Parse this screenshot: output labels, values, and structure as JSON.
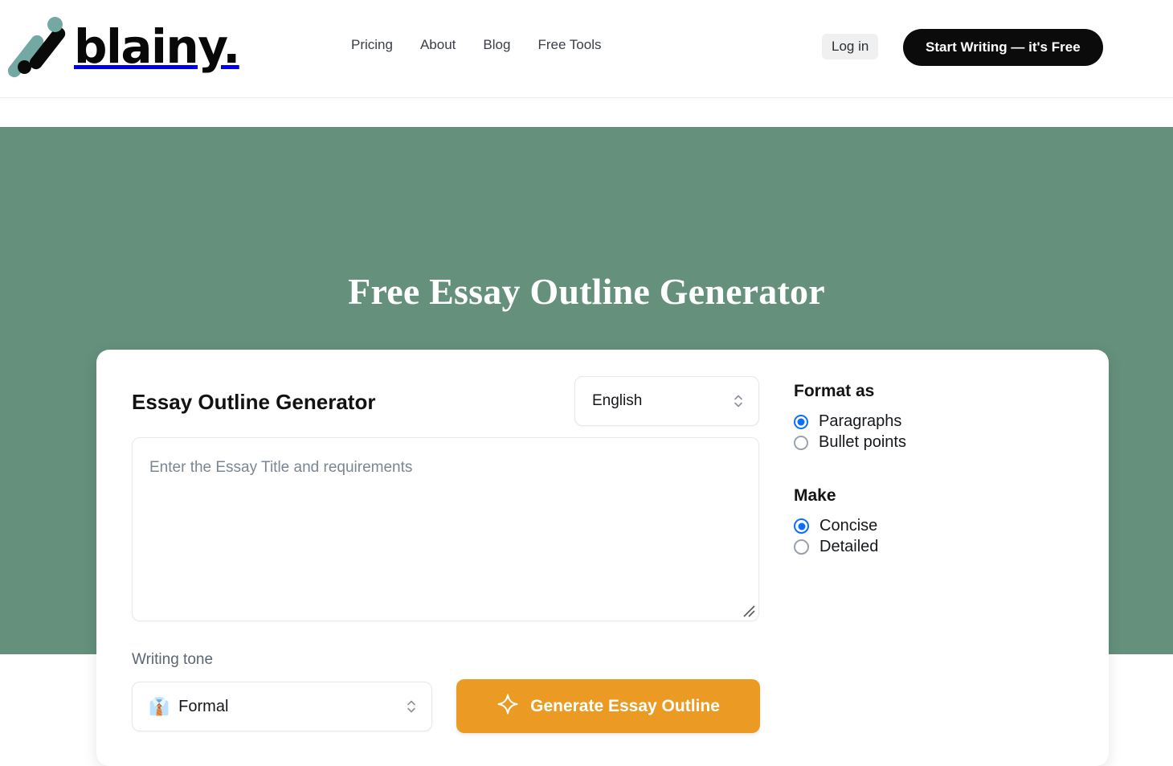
{
  "header": {
    "logo_text": "blainy.",
    "nav": [
      {
        "label": "Pricing"
      },
      {
        "label": "About"
      },
      {
        "label": "Blog"
      },
      {
        "label": "Free Tools"
      }
    ],
    "login_label": "Log in",
    "cta_label": "Start Writing — it's Free"
  },
  "hero": {
    "title": "Free Essay Outline Generator",
    "background_color": "#64907c"
  },
  "card": {
    "panel_title": "Essay Outline Generator",
    "language_select": {
      "value": "English",
      "icon": "chevron-up-down-icon"
    },
    "essay_input": {
      "value": "",
      "placeholder": "Enter the Essay Title and requirements"
    },
    "writing_tone": {
      "label": "Writing tone",
      "emoji": "👔",
      "value": "Formal",
      "icon": "chevron-up-down-icon"
    },
    "generate_button": {
      "label": "Generate Essay Outline",
      "icon": "sparkle-icon",
      "color": "#eb9a23"
    },
    "options": {
      "format": {
        "heading": "Format as",
        "selected": "Paragraphs",
        "items": [
          {
            "label": "Paragraphs",
            "selected": true
          },
          {
            "label": "Bullet points",
            "selected": false
          }
        ]
      },
      "make": {
        "heading": "Make",
        "selected": "Concise",
        "items": [
          {
            "label": "Concise",
            "selected": true
          },
          {
            "label": "Detailed",
            "selected": false
          }
        ]
      },
      "accent_color": "#0d6efd"
    }
  }
}
